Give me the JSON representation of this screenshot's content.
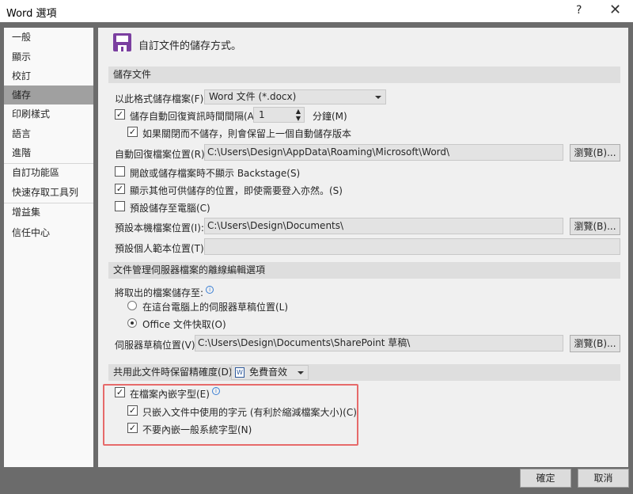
{
  "window": {
    "title": "Word 選項",
    "help": "?",
    "close": "✕"
  },
  "sidebar": {
    "items": [
      {
        "label": "一般"
      },
      {
        "label": "顯示"
      },
      {
        "label": "校訂"
      },
      {
        "label": "儲存"
      },
      {
        "label": "印刷樣式"
      },
      {
        "label": "語言"
      },
      {
        "label": "進階"
      },
      {
        "label": "自訂功能區"
      },
      {
        "label": "快速存取工具列"
      },
      {
        "label": "增益集"
      },
      {
        "label": "信任中心"
      }
    ],
    "selected": "儲存"
  },
  "main": {
    "heading": "自訂文件的儲存方式。",
    "save_section": {
      "title": "儲存文件",
      "format_label": "以此格式儲存檔案(F):",
      "format_value": "Word 文件 (*.docx)",
      "autosave_label": "儲存自動回復資訊時間間隔(A):",
      "autosave_checked": true,
      "autosave_minutes": "1",
      "minutes_label": "分鐘(M)",
      "keep_last_label": "如果關閉而不儲存，則會保留上一個自動儲存版本",
      "keep_last_checked": true,
      "autorecover_label": "自動回復檔案位置(R):",
      "autorecover_path": "C:\\Users\\Design\\AppData\\Roaming\\Microsoft\\Word\\",
      "browse_label": "瀏覽(B)...",
      "no_backstage_label": "開啟或儲存檔案時不顯示 Backstage(S)",
      "no_backstage_checked": false,
      "show_other_label": "顯示其他可供儲存的位置，即使需要登入亦然。(S)",
      "show_other_checked": true,
      "save_to_pc_label": "預設儲存至電腦(C)",
      "save_to_pc_checked": false,
      "default_local_label": "預設本機檔案位置(I):",
      "default_local_path": "C:\\Users\\Design\\Documents\\",
      "personal_templates_label": "預設個人範本位置(T):",
      "personal_templates_path": ""
    },
    "offline_section": {
      "title": "文件管理伺服器檔案的離線編輯選項",
      "save_checked_out_label": "將取出的檔案儲存至:",
      "radio_server_drafts": "在這台電腦上的伺服器草稿位置(L)",
      "radio_office_cache": "Office 文件快取(O)",
      "selected": "Office 文件快取(O)",
      "server_drafts_label": "伺服器草稿位置(V):",
      "server_drafts_path": "C:\\Users\\Design\\Documents\\SharePoint 草稿\\"
    },
    "fidelity_section": {
      "title": "共用此文件時保留精確度(D):",
      "document": "免費音效",
      "embed_fonts_label": "在檔案內嵌字型(E)",
      "embed_fonts_checked": true,
      "embed_used_chars_label": "只嵌入文件中使用的字元 (有利於縮減檔案大小)(C)",
      "embed_used_chars_checked": true,
      "no_common_fonts_label": "不要內嵌一般系統字型(N)",
      "no_common_fonts_checked": true
    }
  },
  "footer": {
    "ok": "確定",
    "cancel": "取消"
  },
  "colors": {
    "accent_icon": "#7b3fa0",
    "highlight_box": "#e66a6a"
  }
}
